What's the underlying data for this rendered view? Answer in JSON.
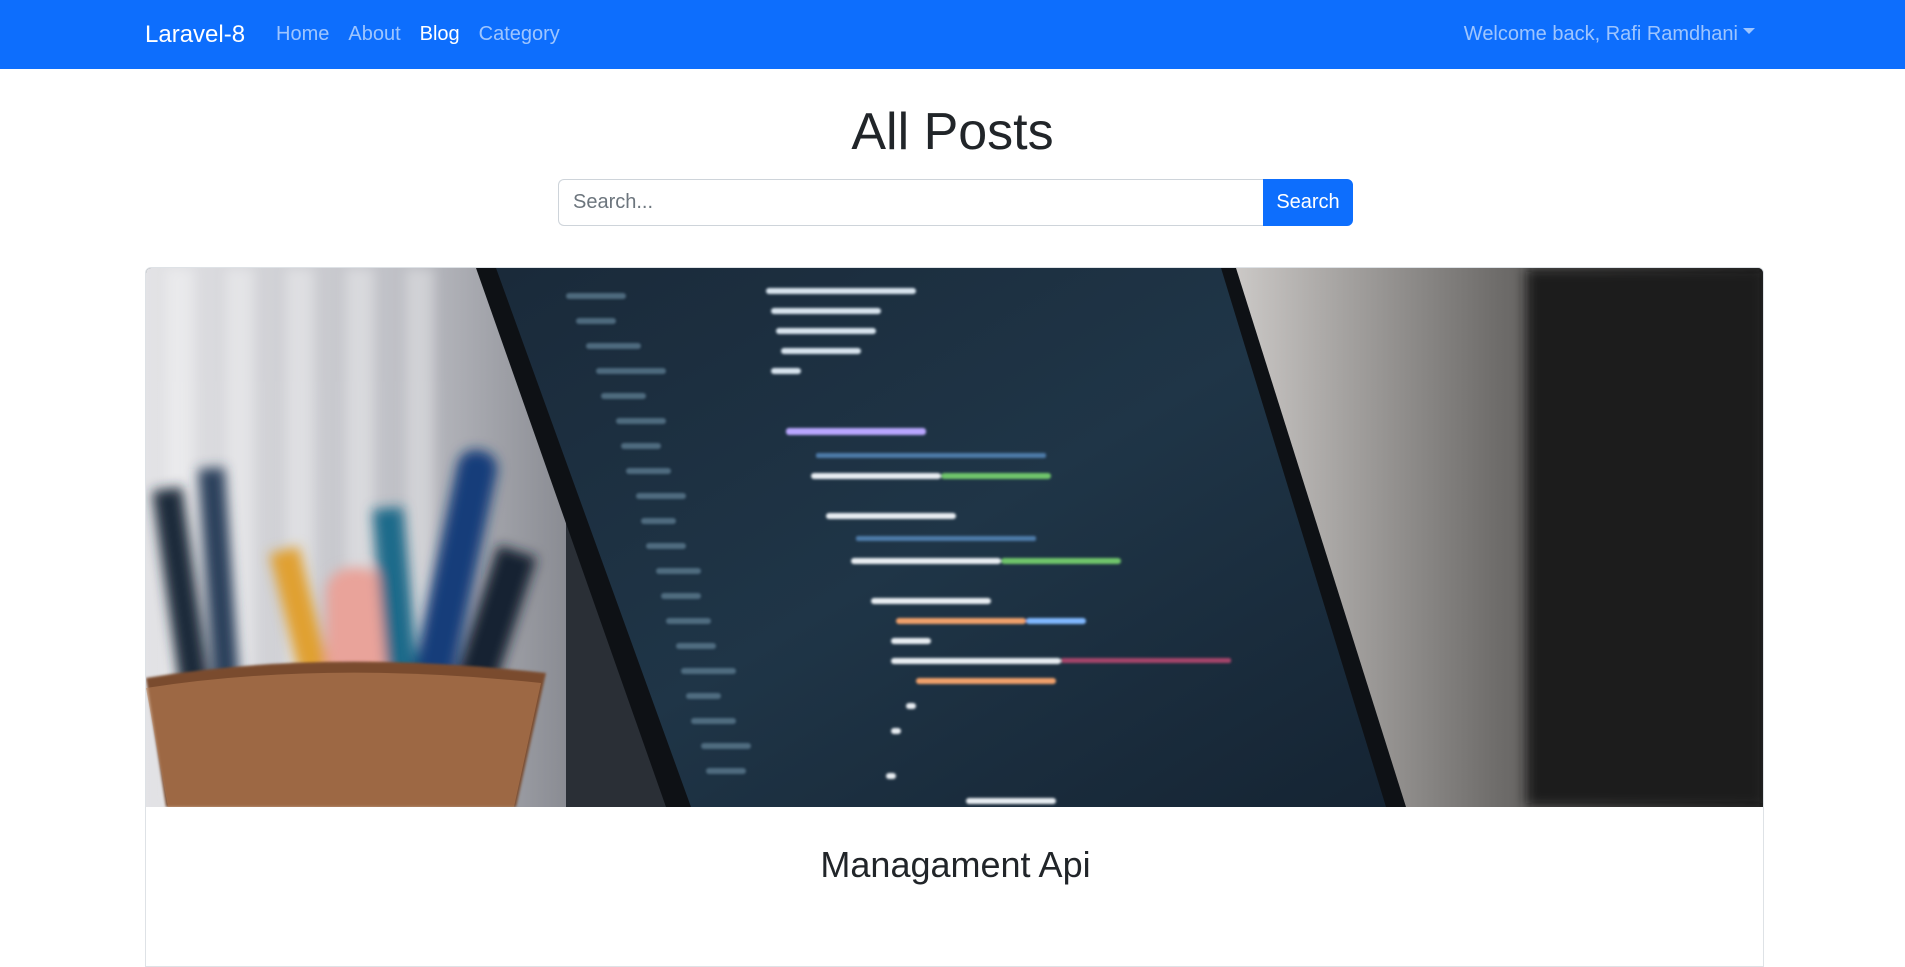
{
  "navbar": {
    "brand": "Laravel-8",
    "links": [
      {
        "label": "Home",
        "active": false
      },
      {
        "label": "About",
        "active": false
      },
      {
        "label": "Blog",
        "active": true
      },
      {
        "label": "Category",
        "active": false
      }
    ],
    "user_menu": "Welcome back, Rafi Ramdhani"
  },
  "main": {
    "title": "All Posts",
    "search": {
      "placeholder": "Search...",
      "value": "",
      "button_label": "Search"
    },
    "featured_post": {
      "image_icon": "code-on-laptop-photo",
      "title": "Managament Api"
    }
  },
  "colors": {
    "primary": "#0d6efd",
    "text": "#212529",
    "border": "#dee2e6"
  }
}
